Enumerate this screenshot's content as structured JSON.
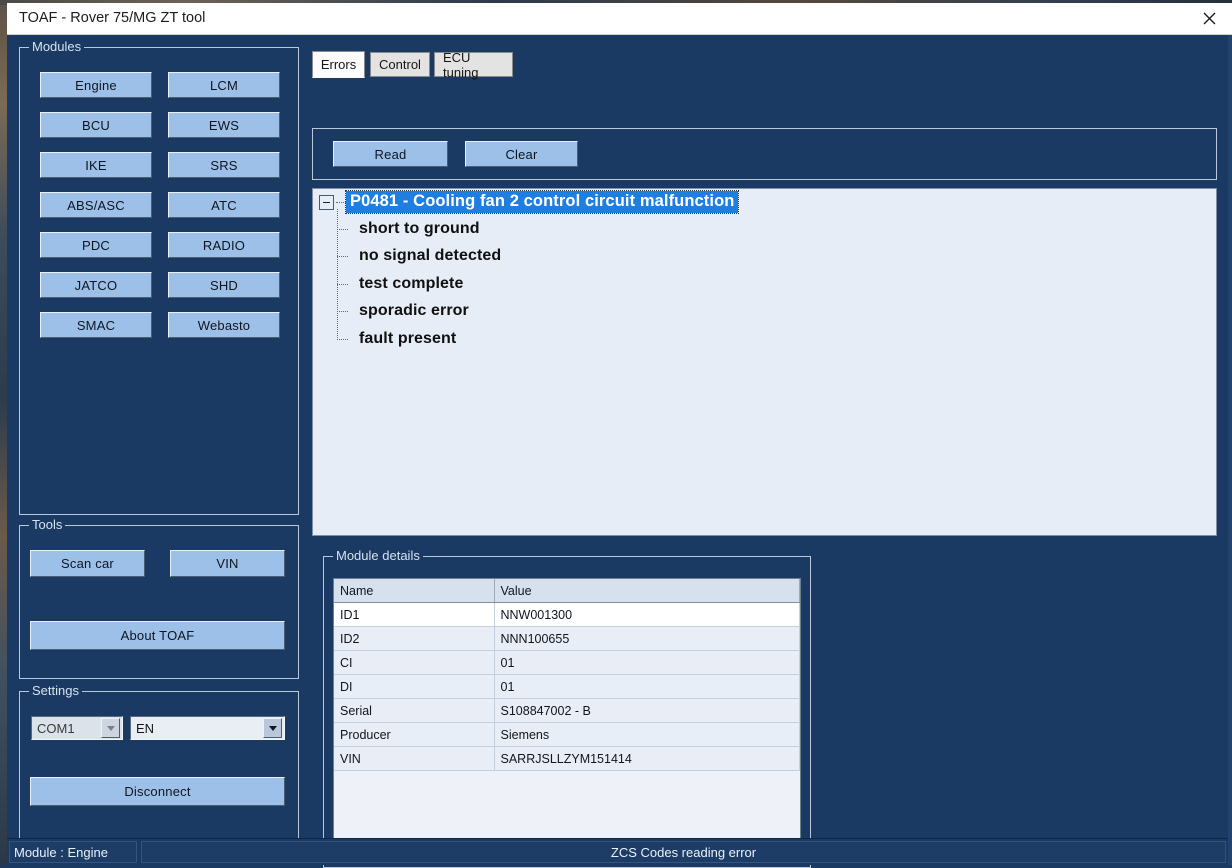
{
  "window": {
    "title": "TOAF - Rover 75/MG ZT tool",
    "close_icon": "close-icon"
  },
  "modules": {
    "group_title": "Modules",
    "buttons": [
      "Engine",
      "LCM",
      "BCU",
      "EWS",
      "IKE",
      "SRS",
      "ABS/ASC",
      "ATC",
      "PDC",
      "RADIO",
      "JATCO",
      "SHD",
      "SMAC",
      "Webasto"
    ]
  },
  "tabs": {
    "items": [
      {
        "label": "Errors",
        "selected": true
      },
      {
        "label": "Control",
        "selected": false
      },
      {
        "label": "ECU tuning",
        "selected": false
      }
    ]
  },
  "errors_toolbar": {
    "read_label": "Read",
    "clear_label": "Clear"
  },
  "error_tree": {
    "root": {
      "label": "P0481 - Cooling fan 2 control circuit malfunction",
      "selected": true,
      "expanded": true,
      "expander_icon": "minus-square-icon"
    },
    "children": [
      "short to ground",
      "no signal detected",
      "test complete",
      "sporadic error",
      "fault present"
    ]
  },
  "tools": {
    "group_title": "Tools",
    "scan_car_label": "Scan car",
    "vin_label": "VIN",
    "about_label": "About TOAF"
  },
  "settings": {
    "group_title": "Settings",
    "port": {
      "value": "COM1",
      "disabled": true,
      "arrow_icon": "chevron-down-icon"
    },
    "language": {
      "value": "EN",
      "disabled": false,
      "arrow_icon": "chevron-down-icon"
    },
    "disconnect_label": "Disconnect"
  },
  "module_details": {
    "group_title": "Module details",
    "columns": [
      "Name",
      "Value"
    ],
    "rows": [
      [
        "ID1",
        "NNW001300"
      ],
      [
        "ID2",
        "NNN100655"
      ],
      [
        "CI",
        "01"
      ],
      [
        "DI",
        "01"
      ],
      [
        "Serial",
        "S108847002 - B"
      ],
      [
        "Producer",
        "Siemens"
      ],
      [
        "VIN",
        "SARRJSLLZYM151414"
      ]
    ]
  },
  "statusbar": {
    "module": "Module : Engine",
    "message": "ZCS Codes reading error"
  },
  "colors": {
    "window_bg": "#1b3a63",
    "button_face": "#9dc0e8",
    "selection_blue": "#1f7fe0",
    "panel_light": "#e6edf6",
    "titlebar": "#ffffff"
  }
}
